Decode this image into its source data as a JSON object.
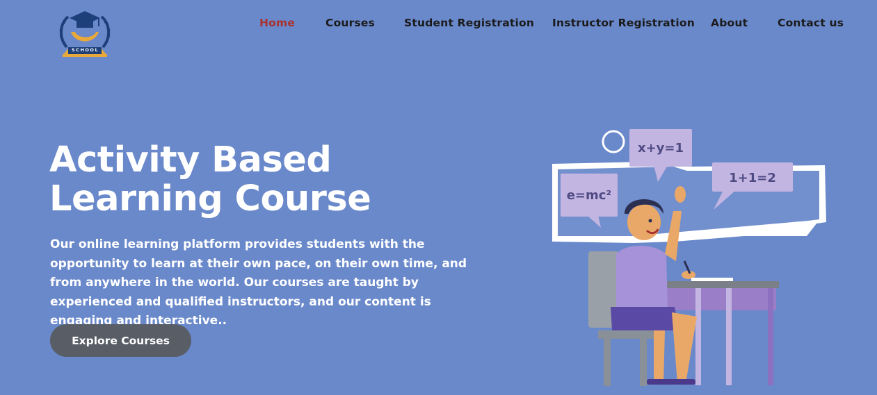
{
  "brand": {
    "logo_text": "SCHOOL",
    "colors": {
      "navy": "#1d3f7a",
      "gold": "#e8a83a"
    }
  },
  "nav": {
    "items": [
      {
        "label": "Home",
        "active": true
      },
      {
        "label": "Courses",
        "active": false
      },
      {
        "label": "Student Registration",
        "active": false
      },
      {
        "label": "Instructor Registration",
        "active": false
      },
      {
        "label": "About",
        "active": false
      },
      {
        "label": "Contact us",
        "active": false
      }
    ]
  },
  "hero": {
    "title_line1": "Activity Based",
    "title_line2": "Learning Course",
    "description": "Our online learning platform provides students with the opportunity to learn at their own pace, on their own time, and from anywhere in the world. Our courses are taught by experienced and qualified instructors, and our content is engaging and interactive..",
    "cta_label": "Explore Courses"
  },
  "illustration": {
    "bubble_1": "e=mc²",
    "bubble_2": "x+y=1",
    "bubble_3": "1+1=2"
  },
  "colors": {
    "background": "#6a89cb",
    "active_nav": "#a8322f",
    "button": "#585d66",
    "bubble": "#c3b5e2"
  }
}
